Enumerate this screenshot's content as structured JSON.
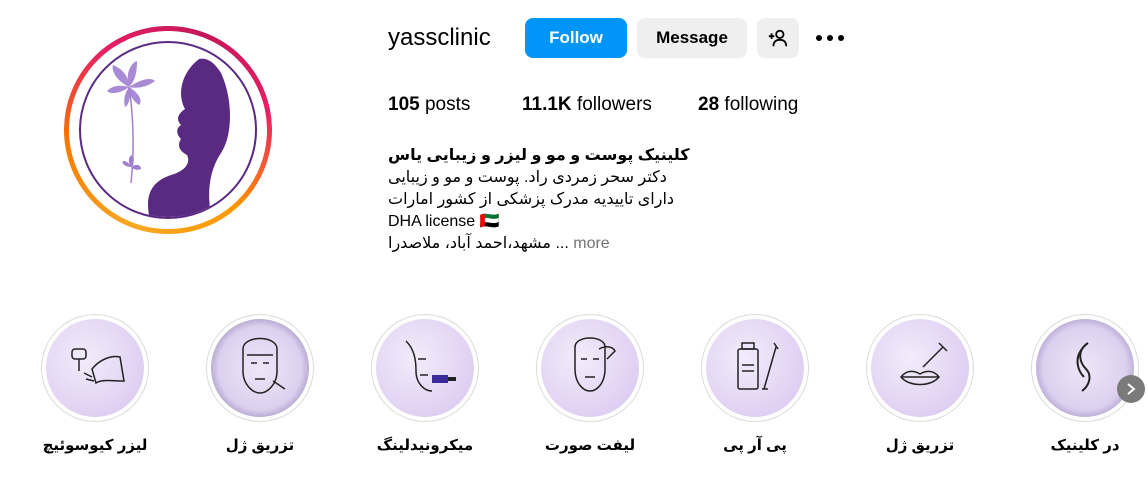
{
  "profile": {
    "username": "yassclinic",
    "follow_label": "Follow",
    "message_label": "Message",
    "add_user_icon": "person-plus-icon",
    "more_icon": "more-horizontal-icon"
  },
  "stats": {
    "posts_count": "105",
    "posts_label": "posts",
    "followers_count": "11.1K",
    "followers_label": "followers",
    "following_count": "28",
    "following_label": "following"
  },
  "bio": {
    "name": "کلینیک پوست و مو و لیزر و زیبایی یاس",
    "line1": "دکتر سحر زمردی راد. پوست و مو و زیبایی",
    "line2": "دارای تاییدیه مدرک پزشکی از کشور امارات",
    "line3": "DHA license 🇦🇪",
    "line4": "مشهد،احمد آباد، ملاصدرا ...",
    "more_label": "more"
  },
  "highlights": [
    {
      "label": "لیزر کیوسوئیچ",
      "icon": "laser-leg-icon"
    },
    {
      "label": "تزریق ژل",
      "icon": "face-injection-icon"
    },
    {
      "label": "میکرونیدلینگ",
      "icon": "microneedling-icon"
    },
    {
      "label": "لیفت صورت",
      "icon": "face-lift-icon"
    },
    {
      "label": "پی آر پی",
      "icon": "prp-vial-icon"
    },
    {
      "label": "تزریق ژل",
      "icon": "lip-injection-icon"
    },
    {
      "label": "در کلینیک",
      "icon": "hair-icon"
    }
  ],
  "colors": {
    "follow_button": "#0095f6",
    "secondary_button": "#efefef",
    "logo_purple": "#5a2a82",
    "highlight_bg": "#e4d6f4"
  }
}
